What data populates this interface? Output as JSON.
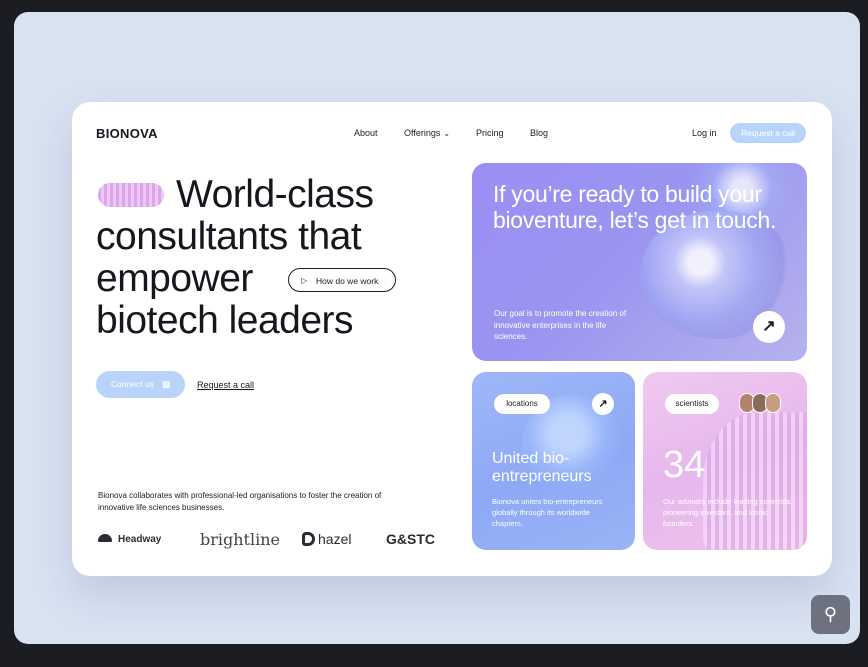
{
  "nav": {
    "logo": "BIONOVA",
    "links": [
      "About",
      "Offerings",
      "Pricing",
      "Blog"
    ],
    "login": "Log in",
    "cta": "Request a call"
  },
  "hero": {
    "line1": "World-class",
    "line2": "consultants that",
    "line3": "empower",
    "line4": "biotech leaders",
    "how_label": "How do we work",
    "connect_label": "Connect us",
    "request_label": "Request a call",
    "blurb": "Bionova collaborates with professional-led organisations to foster the creation of innovative life sciences businesses.",
    "partners": [
      "Headway",
      "brightline",
      "hazel",
      "G&STC"
    ]
  },
  "cards": {
    "bio": {
      "title": "If you’re ready to build your bioventure, let’s get in touch.",
      "subtitle": "Our goal is to promote the creation of innovative enterprises in the life sciences."
    },
    "locations": {
      "chip": "locations",
      "title": "United bio-entrepreneurs",
      "subtitle": "Bionova unites bio-entrepreneurs globally through its worldwide chapters."
    },
    "scientists": {
      "chip": "scientists",
      "number": "34",
      "subtitle": "Our advisors include leading scientists, pioneering investors, and iconic founders."
    }
  },
  "colors": {
    "accent_blue": "#b9d4fb",
    "purple_card": "#9b8ef4",
    "blue_card": "#8ea8f5",
    "pink_card": "#e6b7ee"
  }
}
